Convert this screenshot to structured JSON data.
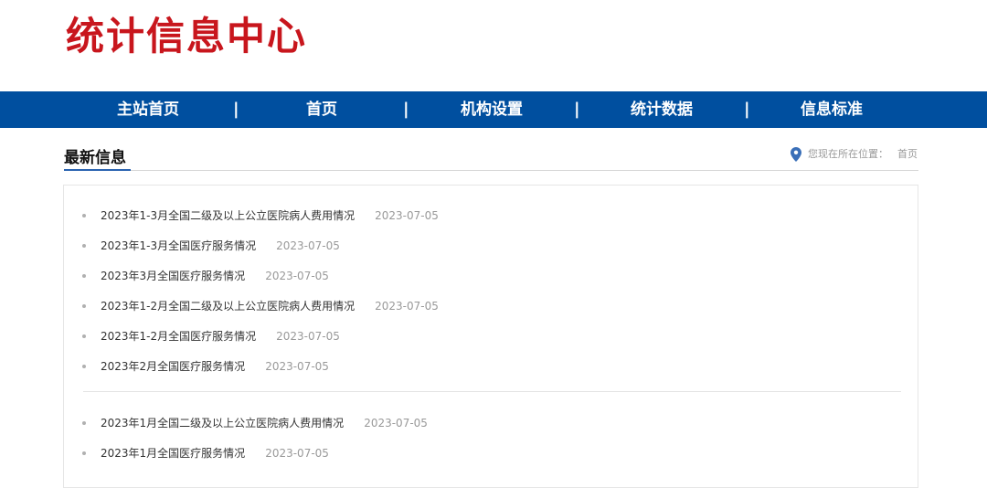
{
  "site": {
    "logo_text": "统计信息中心"
  },
  "nav": {
    "items": [
      "主站首页",
      "首页",
      "机构设置",
      "统计数据",
      "信息标准"
    ],
    "separator": "|"
  },
  "section": {
    "title": "最新信息",
    "location_label": "您现在所在位置：",
    "location_home": "首页"
  },
  "news": [
    {
      "title": "2023年1-3月全国二级及以上公立医院病人费用情况",
      "date": "2023-07-05"
    },
    {
      "title": "2023年1-3月全国医疗服务情况",
      "date": "2023-07-05"
    },
    {
      "title": "2023年3月全国医疗服务情况",
      "date": "2023-07-05"
    },
    {
      "title": "2023年1-2月全国二级及以上公立医院病人费用情况",
      "date": "2023-07-05"
    },
    {
      "title": "2023年1-2月全国医疗服务情况",
      "date": "2023-07-05"
    },
    {
      "title": "2023年2月全国医疗服务情况",
      "date": "2023-07-05"
    },
    {
      "title": "2023年1月全国二级及以上公立医院病人费用情况",
      "date": "2023-07-05"
    },
    {
      "title": "2023年1月全国医疗服务情况",
      "date": "2023-07-05"
    }
  ],
  "colors": {
    "brand_red": "#c8161d",
    "nav_blue": "#004f9f",
    "accent_blue": "#2a63b0",
    "pin_blue": "#3a6fb8"
  },
  "icons": {
    "location": "map-pin-icon"
  }
}
